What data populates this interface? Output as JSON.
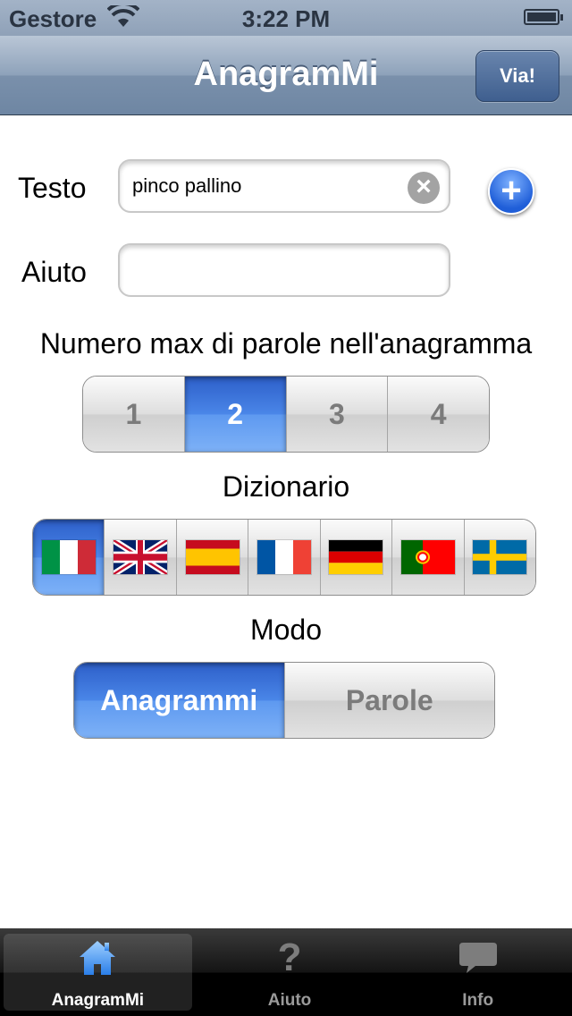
{
  "status": {
    "carrier": "Gestore",
    "time": "3:22 PM"
  },
  "nav": {
    "title": "AnagramMi",
    "go_label": "Via!"
  },
  "form": {
    "text_label": "Testo",
    "text_value": "pinco pallino",
    "help_label": "Aiuto",
    "help_value": ""
  },
  "max_words": {
    "title": "Numero max di parole nell'anagramma",
    "options": [
      "1",
      "2",
      "3",
      "4"
    ],
    "selected": "2"
  },
  "dictionary": {
    "title": "Dizionario",
    "flags": [
      "italy-flag-icon",
      "uk-flag-icon",
      "spain-flag-icon",
      "france-flag-icon",
      "germany-flag-icon",
      "portugal-flag-icon",
      "sweden-flag-icon"
    ],
    "selected": "italy-flag-icon"
  },
  "mode": {
    "title": "Modo",
    "options": [
      "Anagrammi",
      "Parole"
    ],
    "selected": "Anagrammi"
  },
  "tabs": [
    {
      "label": "AnagramMi",
      "icon": "house-icon",
      "selected": true
    },
    {
      "label": "Aiuto",
      "icon": "question-icon",
      "selected": false
    },
    {
      "label": "Info",
      "icon": "speech-bubble-icon",
      "selected": false
    }
  ],
  "colors": {
    "accent": "#4a86e8",
    "nav_button": "#3f5f8f"
  }
}
